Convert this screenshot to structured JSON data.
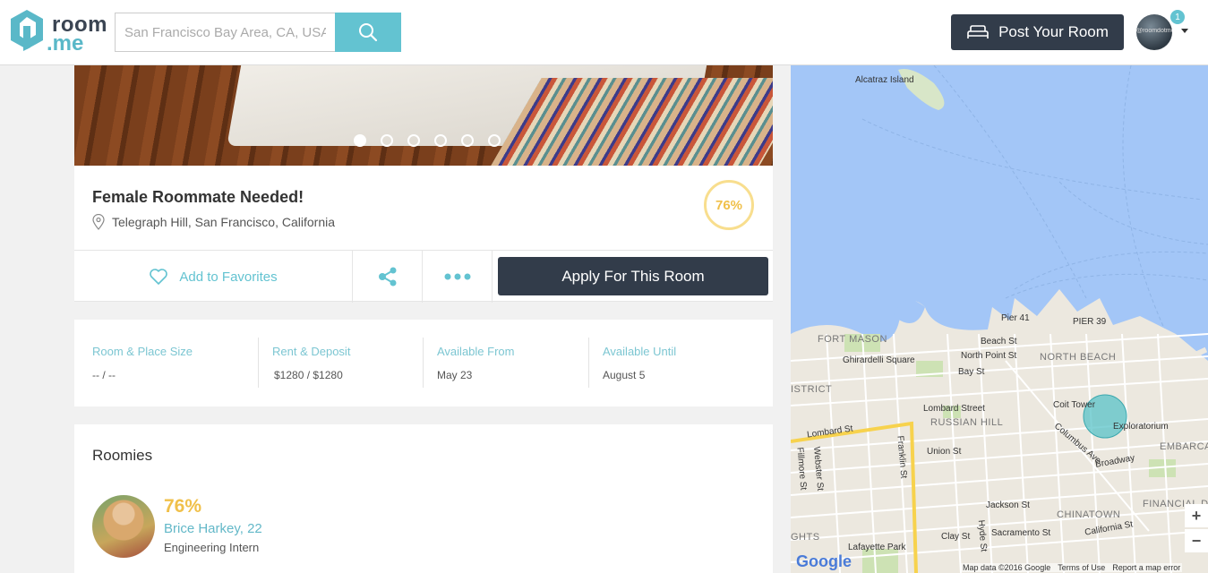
{
  "header": {
    "logo_line1": "room",
    "logo_line2": ".me",
    "search_placeholder": "San Francisco Bay Area, CA, USA",
    "post_button": "Post Your Room",
    "avatar_text": "@roomdotme",
    "notification_count": "1"
  },
  "listing": {
    "title": "Female Roommate Needed!",
    "location": "Telegraph Hill, San Francisco, California",
    "match_score": "76%",
    "photo_count": 6,
    "active_photo": 0,
    "actions": {
      "favorite": "Add to Favorites",
      "apply": "Apply For This Room"
    }
  },
  "details": [
    {
      "label": "Room & Place Size",
      "value": "-- / --"
    },
    {
      "label": "Rent & Deposit",
      "value": "$1280 /  $1280"
    },
    {
      "label": "Available From",
      "value": "May 23"
    },
    {
      "label": "Available Until",
      "value": "August 5"
    }
  ],
  "roomies": {
    "heading": "Roomies",
    "people": [
      {
        "score": "76%",
        "name": "Brice Harkey, 22",
        "role": "Engineering Intern"
      }
    ]
  },
  "map": {
    "labels": {
      "alcatraz": "Alcatraz Island",
      "pier41": "Pier 41",
      "pier39": "PIER 39",
      "fort_mason": "FORT MASON",
      "beach_st": "Beach St",
      "north_point": "North Point St",
      "north_beach": "NORTH BEACH",
      "ghirardelli": "Ghirardelli Square",
      "bay_st": "Bay St",
      "district": "ISTRICT",
      "lombard_street": "Lombard Street",
      "coit_tower": "Coit Tower",
      "russian_hill": "RUSSIAN HILL",
      "exploratorium": "Exploratorium",
      "lombard_st": "Lombard St",
      "franklin_st": "Franklin St",
      "union_st": "Union St",
      "columbus_ave": "Columbus Ave",
      "broadway": "Broadway",
      "embarcadero": "EMBARCAD",
      "fillmore_st": "Fillmore St",
      "webster_st": "Webster St",
      "jackson_st": "Jackson St",
      "financial": "FINANCIAL DISTRI",
      "chinatown": "CHINATOWN",
      "heights": "GHTS",
      "lafayette": "Lafayette Park",
      "clay_st": "Clay St",
      "hyde_st": "Hyde St",
      "sacramento_st": "Sacramento St",
      "california_st": "California St"
    },
    "zoom_in": "+",
    "zoom_out": "−",
    "google": "Google",
    "attribution": [
      "Map data ©2016 Google",
      "Terms of Use",
      "Report a map error"
    ]
  }
}
